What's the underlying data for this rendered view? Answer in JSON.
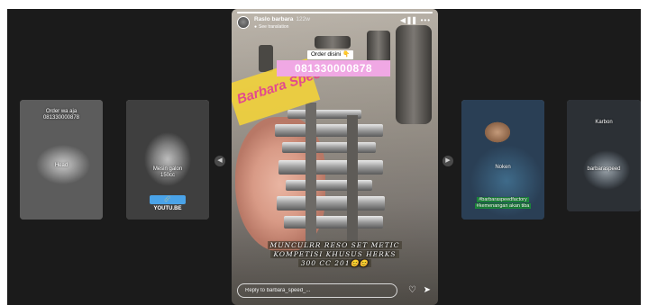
{
  "story": {
    "username": "Raslo barbara",
    "time_ago": "122w",
    "translation_label": "See translation",
    "progress": 1.0,
    "sticker_order": "Order disini",
    "sticker_order_emoji": "👇",
    "sticker_phone": "081330000878",
    "banner_text": "Barbara Speed",
    "caption_lines": [
      "MUNCULRR RESO SET METIC",
      "KOMPETISI KHUSUS HERKS",
      "300 CC 201😊😊"
    ],
    "reply_placeholder": "Reply to barbara_speed_..."
  },
  "side_cards": {
    "a": {
      "top_caption_1": "Order wa aja",
      "top_caption_2": "081330000878",
      "label": "Head"
    },
    "b": {
      "label_1": "Mesin galon",
      "label_2": "150cc",
      "badge": "YOUTU.BE"
    },
    "c": {
      "label": "Noken",
      "tag_1": "#barbaraspeedfactory",
      "tag_2": "#kemenangan akan tiba"
    },
    "d": {
      "top_label": "Karbon",
      "label": "barbaraspeed"
    }
  },
  "icons": {
    "left_arrow": "chevron-left-icon",
    "right_arrow": "chevron-right-icon",
    "sound": "speaker-icon",
    "pause": "pause-icon",
    "more": "more-icon",
    "heart": "heart-icon",
    "send": "send-icon",
    "globe": "globe-icon"
  },
  "colors": {
    "viewer_bg": "#1b1b1b",
    "phone_sticker": "#f0a8e4",
    "banner_yellow": "#f2d23a",
    "banner_pink": "#e24a8d",
    "youtube_badge": "#4aa3e8"
  }
}
